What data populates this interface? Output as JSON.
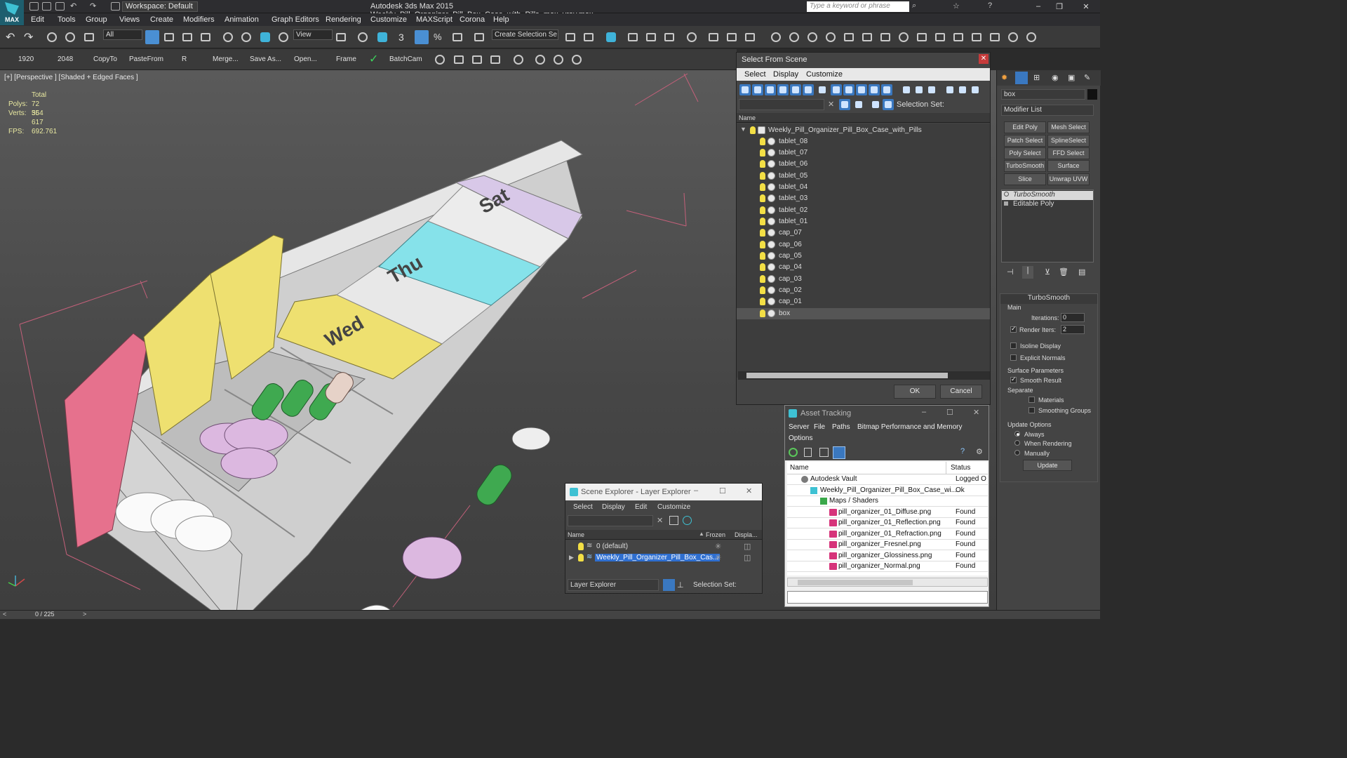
{
  "app": {
    "title": "Autodesk 3ds Max  2015     Weekly_Pill_Organizer_Pill_Box_Case_with_Pills_max_vray.max",
    "logo_text": "MAX",
    "workspace": "Workspace: Default",
    "search_placeholder": "Type a keyword or phrase"
  },
  "menu": [
    "Edit",
    "Tools",
    "Group",
    "Views",
    "Create",
    "Modifiers",
    "Animation",
    "Graph Editors",
    "Rendering",
    "Customize",
    "MAXScript",
    "Corona",
    "Help"
  ],
  "toolbar": {
    "selection_filter": "All",
    "ref_coord": "View",
    "named_selection": "Create Selection Se",
    "snap_number": "3"
  },
  "toolbar2": [
    "1920",
    "2048",
    "CopyTo",
    "PasteFrom",
    "R",
    "Merge...",
    "Save As...",
    "Open...",
    "Frame",
    "BatchCam"
  ],
  "viewport": {
    "label": "[+] [Perspective ] [Shaded + Edged Faces ]",
    "stats_total": "Total",
    "polys_label": "Polys:",
    "polys_value": "72 554",
    "verts_label": "Verts:",
    "verts_value": "36 617",
    "fps_label": "FPS:",
    "fps_value": "692.761",
    "lid_labels": [
      "Wed",
      "Thu",
      "Sat"
    ]
  },
  "select_from_scene": {
    "title": "Select From Scene",
    "menu": [
      "Select",
      "Display",
      "Customize"
    ],
    "selection_set_label": "Selection Set:",
    "column_name": "Name",
    "root": "Weekly_Pill_Organizer_Pill_Box_Case_with_Pills",
    "items": [
      "tablet_08",
      "tablet_07",
      "tablet_06",
      "tablet_05",
      "tablet_04",
      "tablet_03",
      "tablet_02",
      "tablet_01",
      "cap_07",
      "cap_06",
      "cap_05",
      "cap_04",
      "cap_03",
      "cap_02",
      "cap_01",
      "box"
    ],
    "selected": "box",
    "ok": "OK",
    "cancel": "Cancel"
  },
  "asset_tracking": {
    "title": "Asset Tracking",
    "menu": [
      "Server",
      "File",
      "Paths",
      "Bitmap Performance and Memory",
      "Options"
    ],
    "col_name": "Name",
    "col_status": "Status",
    "rows": [
      {
        "name": "Autodesk Vault",
        "status": "Logged O"
      },
      {
        "name": "Weekly_Pill_Organizer_Pill_Box_Case_wi...",
        "status": "Ok"
      },
      {
        "name": "Maps / Shaders",
        "status": ""
      },
      {
        "name": "pill_organizer_01_Diffuse.png",
        "status": "Found"
      },
      {
        "name": "pill_organizer_01_Reflection.png",
        "status": "Found"
      },
      {
        "name": "pill_organizer_01_Refraction.png",
        "status": "Found"
      },
      {
        "name": "pill_organizer_Fresnel.png",
        "status": "Found"
      },
      {
        "name": "pill_organizer_Glossiness.png",
        "status": "Found"
      },
      {
        "name": "pill_organizer_Normal.png",
        "status": "Found"
      }
    ]
  },
  "scene_explorer": {
    "title": "Scene Explorer - Layer Explorer",
    "menu": [
      "Select",
      "Display",
      "Edit",
      "Customize"
    ],
    "col_name": "Name",
    "col_frozen": "Frozen",
    "col_display": "Displa...",
    "rows": [
      "0 (default)",
      "Weekly_Pill_Organizer_Pill_Box_Cas..."
    ],
    "explorer_select": "Layer Explorer",
    "selection_set_label": "Selection Set:"
  },
  "command_panel": {
    "object_name": "box",
    "modifier_list": "Modifier List",
    "mod_buttons": [
      "Edit Poly",
      "Mesh Select",
      "Patch Select",
      "SplineSelect",
      "Poly Select",
      "FFD Select",
      "TurboSmooth",
      "Surface Select",
      "Slice",
      "Unwrap UVW"
    ],
    "stack": [
      "TurboSmooth",
      "Editable Poly"
    ],
    "rollout_title": "TurboSmooth",
    "main_label": "Main",
    "iterations_label": "Iterations:",
    "iterations_value": "0",
    "render_iters_label": "Render Iters:",
    "render_iters_value": "2",
    "isoline_label": "Isoline Display",
    "explicit_normals_label": "Explicit Normals",
    "surface_params_label": "Surface Parameters",
    "smooth_result_label": "Smooth Result",
    "separate_label": "Separate",
    "materials_label": "Materials",
    "smoothing_groups_label": "Smoothing Groups",
    "update_options_label": "Update Options",
    "always_label": "Always",
    "when_rendering_label": "When Rendering",
    "manually_label": "Manually",
    "update_button": "Update"
  },
  "status": {
    "timeline": "0 / 225"
  }
}
